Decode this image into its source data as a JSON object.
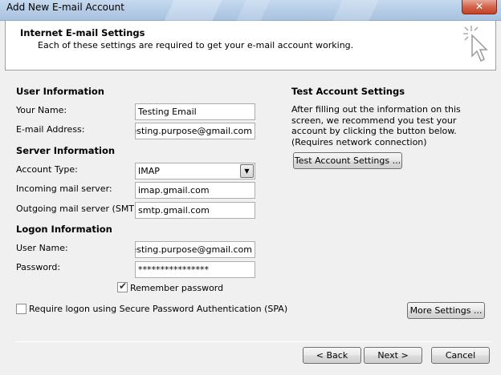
{
  "window": {
    "title": "Add New E-mail Account",
    "close_label": "✕"
  },
  "header": {
    "title": "Internet E-mail Settings",
    "subtitle": "Each of these settings are required to get your e-mail account working."
  },
  "user_info": {
    "section": "User Information",
    "name_label": "Your Name:",
    "name_value": "Testing Email",
    "email_label": "E-mail Address:",
    "email_value": "n.testing.purpose@gmail.com"
  },
  "server_info": {
    "section": "Server Information",
    "account_type_label": "Account Type:",
    "account_type_value": "IMAP",
    "incoming_label": "Incoming mail server:",
    "incoming_value": "imap.gmail.com",
    "outgoing_label": "Outgoing mail server (SMTP):",
    "outgoing_value": "smtp.gmail.com"
  },
  "logon_info": {
    "section": "Logon Information",
    "username_label": "User Name:",
    "username_value": "n.testing.purpose@gmail.com",
    "password_label": "Password:",
    "password_value": "****************",
    "remember_label": "Remember password",
    "remember_checked": true,
    "spa_label": "Require logon using Secure Password Authentication (SPA)",
    "spa_checked": false
  },
  "test_settings": {
    "section": "Test Account Settings",
    "description": "After filling out the information on this screen, we recommend you test your account by clicking the button below. (Requires network connection)",
    "test_button": "Test Account Settings ...",
    "more_button": "More Settings ..."
  },
  "footer": {
    "back": "< Back",
    "next": "Next >",
    "cancel": "Cancel"
  }
}
